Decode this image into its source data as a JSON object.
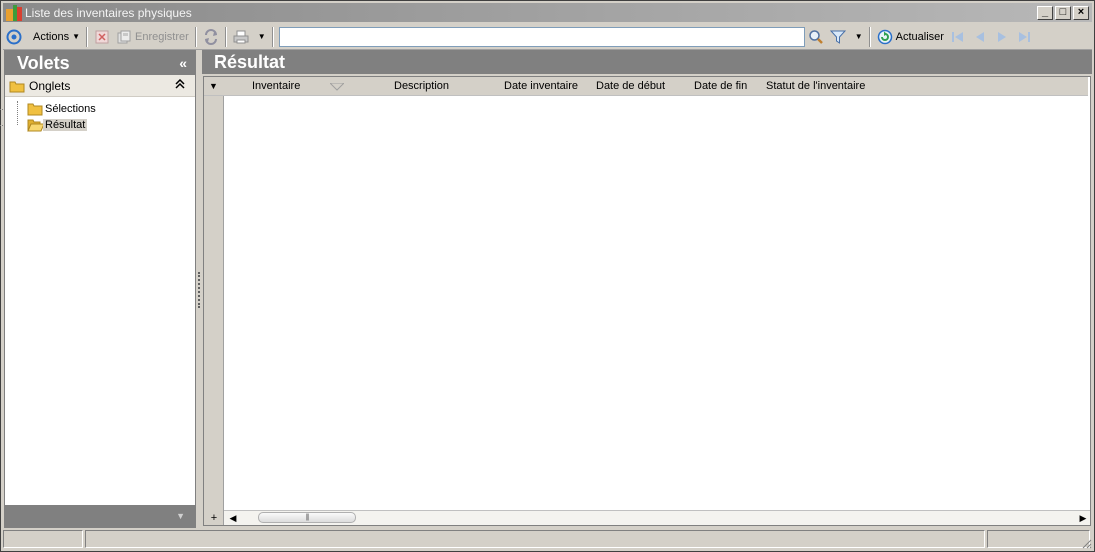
{
  "window": {
    "title": "Liste des inventaires physiques",
    "controls": [
      "_",
      "□",
      "×"
    ]
  },
  "toolbar": {
    "actions_label": "Actions",
    "save_label": "Enregistrer",
    "search_value": "",
    "refresh_label": "Actualiser"
  },
  "left_panel": {
    "title": "Volets",
    "collapse_glyph": "«",
    "group_label": "Onglets",
    "group_collapse_glyph": "⌃",
    "items": [
      {
        "label": "Sélections",
        "selected": false
      },
      {
        "label": "Résultat",
        "selected": true
      }
    ]
  },
  "right_panel": {
    "title": "Résultat",
    "columns": [
      "Inventaire",
      "Description",
      "Date inventaire",
      "Date de début",
      "Date de fin",
      "Statut de l'inventaire"
    ],
    "rows": []
  },
  "colors": {
    "header_bg": "#808080",
    "chrome_bg": "#d4d0c8",
    "accent_blue": "#2a6fc9",
    "folder_yellow": "#f0c040"
  }
}
